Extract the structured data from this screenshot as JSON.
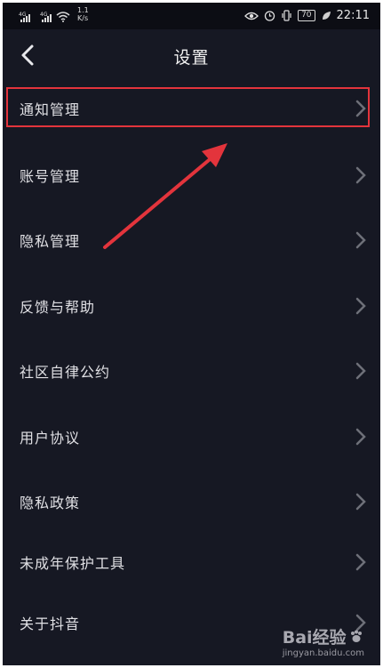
{
  "status_bar": {
    "sim1_tag": "4G",
    "sim2_tag": "4G",
    "speed_value": "1.1",
    "speed_unit": "K/s",
    "battery": "70",
    "time": "22:11"
  },
  "header": {
    "title": "设置"
  },
  "menu": [
    {
      "label": "通知管理"
    },
    {
      "label": "账号管理"
    },
    {
      "label": "隐私管理"
    },
    {
      "label": "反馈与帮助"
    },
    {
      "label": "社区自律公约"
    },
    {
      "label": "用户协议"
    },
    {
      "label": "隐私政策"
    },
    {
      "label": "未成年保护工具"
    },
    {
      "label": "关于抖音"
    }
  ],
  "annotation": {
    "highlight_color": "#e3343c"
  },
  "watermark": {
    "brand": "Bai经验",
    "url": "jingyan.baidu.com"
  },
  "colors": {
    "background": "#161823",
    "text": "#e0e0e4",
    "chevron": "#6e7079"
  }
}
